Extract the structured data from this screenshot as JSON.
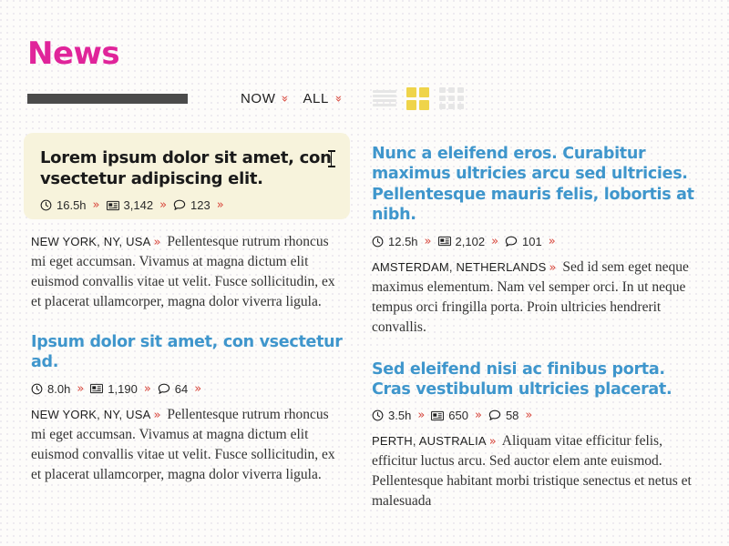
{
  "masthead": {
    "title": "News"
  },
  "toolbar": {
    "progress_bar_name": "progress-bar",
    "filters": [
      {
        "label": "NOW",
        "icon": "chevron-down-icon"
      },
      {
        "label": "ALL",
        "icon": "chevron-down-icon"
      }
    ],
    "view_modes": [
      {
        "name": "list-view",
        "active": false
      },
      {
        "name": "grid-2x2-view",
        "active": true
      },
      {
        "name": "grid-3x3-view",
        "active": false
      }
    ],
    "colors": {
      "accent_pink": "#e0249a",
      "accent_red": "#d8453a",
      "accent_blue": "#3f96cc",
      "accent_yellow": "#efd44a",
      "progress_bar": "#4b4b4b",
      "featured_bg": "#f7f3dc"
    }
  },
  "columns": [
    {
      "name": "left-column",
      "articles": [
        {
          "featured": true,
          "headline_part1": "Lorem ipsum dolor sit amet, con",
          "headline_part2": "vsectetur adipiscing elit.",
          "headline": "Lorem ipsum dolor sit amet, convsectetur adipiscing elit.",
          "meta": {
            "time": "16.5h",
            "reads": "3,142",
            "comments": "123",
            "separator": "»"
          },
          "dateline": "NEW YORK, NY, USA",
          "dateline_separator": "»",
          "body": "Pellentesque rutrum rhoncus mi eget accumsan. Vivamus at magna dictum elit euismod convallis vitae ut velit. Fusce sollicitudin, ex et placerat ullamcorper, magna dolor viverra ligula."
        },
        {
          "featured": false,
          "headline": "Ipsum dolor sit amet, con vsectetur ad.",
          "meta": {
            "time": "8.0h",
            "reads": "1,190",
            "comments": "64",
            "separator": "»"
          },
          "dateline": "NEW YORK, NY, USA",
          "dateline_separator": "»",
          "body": "Pellentesque rutrum rhoncus mi eget accumsan. Vivamus at magna dictum elit euismod convallis vitae ut velit. Fusce sollicitudin, ex et placerat ullamcorper, magna dolor viverra ligula."
        }
      ]
    },
    {
      "name": "right-column",
      "articles": [
        {
          "featured": false,
          "headline": "Nunc a eleifend eros. Curabitur maximus ultricies arcu sed ultricies. Pellentesque mauris felis, lobortis at nibh.",
          "meta": {
            "time": "12.5h",
            "reads": "2,102",
            "comments": "101",
            "separator": "»"
          },
          "dateline": "AMSTERDAM, NETHERLANDS",
          "dateline_separator": "»",
          "body": "Sed id sem eget neque maximus elementum. Nam vel semper orci. In ut neque tempus orci fringilla porta. Proin ultricies hendrerit convallis."
        },
        {
          "featured": false,
          "headline": "Sed eleifend nisi ac finibus porta. Cras vestibulum ultricies placerat.",
          "meta": {
            "time": "3.5h",
            "reads": "650",
            "comments": "58",
            "separator": "»"
          },
          "dateline": "PERTH, AUSTRALIA",
          "dateline_separator": "»",
          "body": "Aliquam vitae efficitur felis, efficitur luctus arcu. Sed auctor elem ante euismod. Pellentesque habitant morbi tristique senectus et netus et malesuada"
        }
      ]
    }
  ],
  "icons": {
    "clock": "clock-icon",
    "reads": "newspaper-icon",
    "comments": "comment-bubble-icon"
  }
}
